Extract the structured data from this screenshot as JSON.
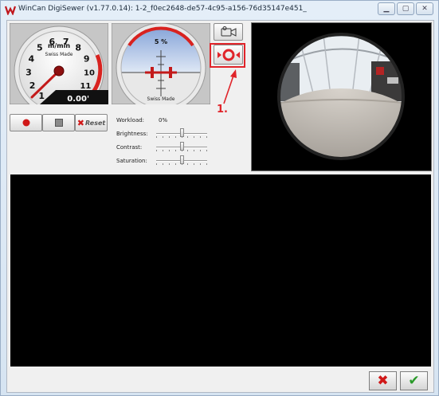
{
  "window": {
    "title": "WinCan DigiSewer (v1.77.0.14): 1-2_f0ec2648-de57-4c95-a156-76d35147e451_"
  },
  "speed_gauge": {
    "unit_label": "m/min",
    "brand_label": "Swiss Made",
    "ticks": [
      "1",
      "2",
      "3",
      "4",
      "5",
      "6",
      "7",
      "8",
      "9",
      "10",
      "11",
      "12"
    ],
    "readout": "0.00'",
    "needle_value": 0
  },
  "inclination_gauge": {
    "value_label": "5 %",
    "brand_label": "Swiss Made"
  },
  "record_controls": {
    "reset_label": "Reset"
  },
  "settings": {
    "workload_label": "Workload:",
    "workload_value": "0%",
    "brightness_label": "Brightness:",
    "contrast_label": "Contrast:",
    "saturation_label": "Saturation:",
    "brightness_level": 0.5,
    "contrast_level": 0.5,
    "saturation_level": 0.5
  },
  "annotation": {
    "step_label": "1."
  },
  "colors": {
    "accent_red": "#e0242a",
    "confirm_green": "#2a9a2a"
  },
  "icons": {
    "camera": "video-camera-icon",
    "recording": "record-ring-icon",
    "cancel": "close-x-icon",
    "confirm": "checkmark-icon"
  }
}
